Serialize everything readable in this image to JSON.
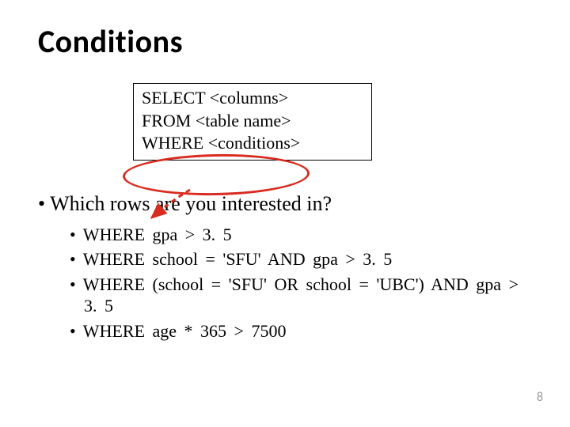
{
  "title": "Conditions",
  "sql": {
    "line1": "SELECT <columns>",
    "line2": "FROM   <table name>",
    "line3": "WHERE  <conditions>"
  },
  "question": "• Which  rows  are  you  interested  in?",
  "examples": [
    "• WHERE gpa  >  3. 5",
    "• WHERE  school  =  'SFU'  AND  gpa  >  3. 5",
    "• WHERE  (school  =  'SFU'  OR  school  =  'UBC')  AND gpa  >  3. 5",
    "• WHERE age  *  365  >  7500"
  ],
  "page_number": "8",
  "highlight_color": "#d92b1f"
}
